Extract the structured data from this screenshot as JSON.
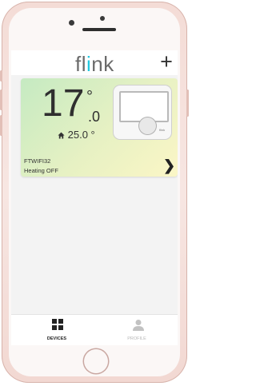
{
  "app": {
    "logo_prefix": "fl",
    "logo_highlight": "i",
    "logo_suffix": "nk",
    "add_label": "+"
  },
  "device": {
    "temperature_integer": "17",
    "temperature_decimal": ".0",
    "degree_symbol": "°",
    "setpoint_text": "25.0 °",
    "name": "FTWIFI32",
    "status": "Heating OFF",
    "thermostat_brand": "flink"
  },
  "tabs": [
    {
      "label": "DEVICES",
      "active": true
    },
    {
      "label": "PROFILE",
      "active": false
    }
  ],
  "colors": {
    "accent": "#20c8e0",
    "card_start": "#c5eac2",
    "card_end": "#fbf6c6",
    "phone_frame": "#f4dcd6"
  }
}
